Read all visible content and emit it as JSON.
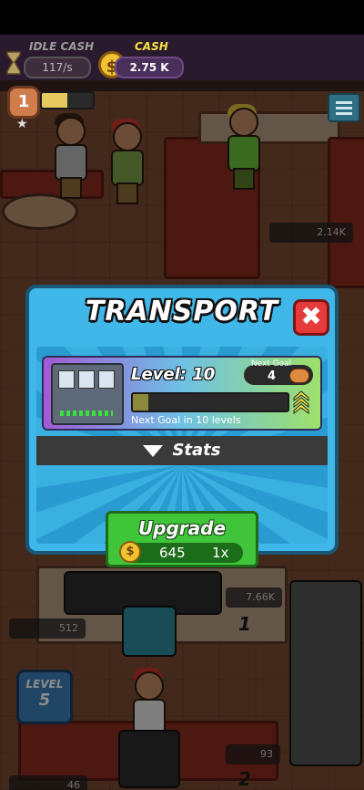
{
  "hud": {
    "idle_cash_label": "IDLE CASH",
    "idle_cash_value": "117/s",
    "cash_label": "CASH",
    "cash_value": "2.75 K",
    "player_level": "1",
    "player_xp_fraction": 0.5
  },
  "scene": {
    "pills": {
      "top_right": "2.14K",
      "mid_right": "7.66K",
      "left_512": "512",
      "bottom_93": "93",
      "bottom_left_46": "46"
    },
    "station_numbers": [
      "1",
      "2"
    ],
    "level_badge": {
      "label": "LEVEL",
      "value": "5"
    }
  },
  "modal": {
    "title": "TRANSPORT",
    "close_symbol": "✖",
    "level_label": "Level: 10",
    "next_goal_label": "Next Goal",
    "next_goal_value": "4",
    "next_goal_caption": "Next Goal in 10 levels",
    "progress_fraction": 0.1,
    "stats_label": "Stats"
  },
  "upgrade": {
    "label": "Upgrade",
    "cost": "645",
    "multiplier": "1x"
  },
  "colors": {
    "modal_bg": "#3fb7e8",
    "upgrade_green": "#3fc43a",
    "close_red": "#e63b3b",
    "cash_yellow": "#f4e13a"
  }
}
